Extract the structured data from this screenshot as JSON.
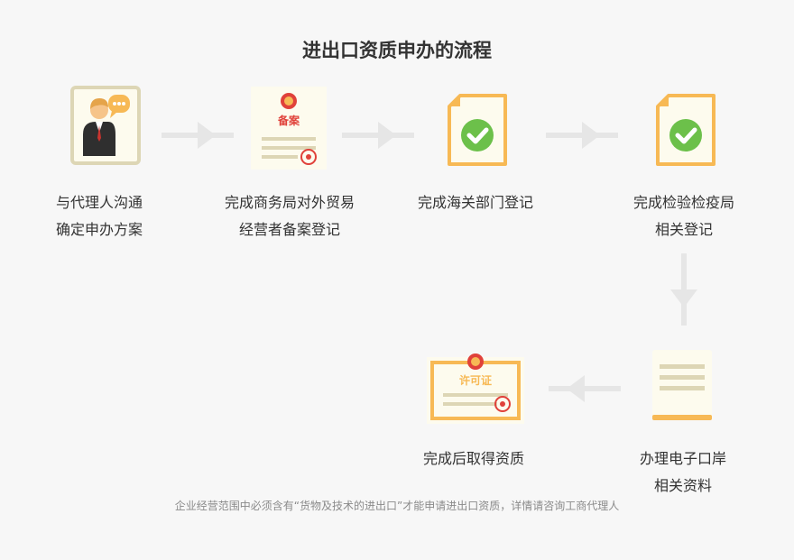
{
  "title": "进出口资质申办的流程",
  "steps": [
    {
      "line1": "与代理人沟通",
      "line2": "确定申办方案"
    },
    {
      "line1": "完成商务局对外贸易",
      "line2": "经营者备案登记",
      "stamp_text": "备案"
    },
    {
      "line1": "完成海关部门登记",
      "line2": ""
    },
    {
      "line1": "完成检验检疫局",
      "line2": "相关登记"
    },
    {
      "line1": "办理电子口岸",
      "line2": "相关资料"
    },
    {
      "line1": "完成后取得资质",
      "line2": "",
      "stamp_text": "许可证"
    }
  ],
  "footnote": "企业经营范围中必须含有“货物及技术的进出口”才能申请进出口资质，详情请咨询工商代理人",
  "icons": [
    "agent-icon",
    "filing-certificate-icon",
    "checked-document-icon",
    "checked-document-icon",
    "document-icon",
    "license-certificate-icon"
  ],
  "colors": {
    "orange": "#f7b955",
    "green": "#6cc04a",
    "arrow": "#e6e6e6",
    "seal_red": "#e0413a",
    "paper": "#fdfbee"
  }
}
